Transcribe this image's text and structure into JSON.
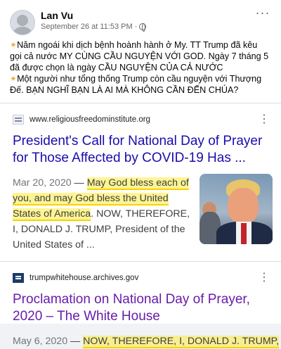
{
  "post": {
    "author": "Lan Vu",
    "timestamp": "September 26 at 11:53 PM",
    "dot": "·",
    "paragraph1": "Năm ngoái khi dịch bệnh hoành hành ở My. TT Trump đã kêu gọi cả nước MY CÙNG CẦU NGUYỆN VỚI GOD.  Ngày 7 tháng 5 đã được chọn là ngày CẦU NGUYỆN CỦA CẢ NƯỚC",
    "paragraph2": "Một người như tổng thống Trump còn cầu nguyện với Thượng Đế. BẠN NGHĨ BẠN LÀ AI MÀ KHÔNG CẦN ĐẾN CHÚA?",
    "spark_icon": "✴",
    "more_icon": "···"
  },
  "results": [
    {
      "site": "www.religiousfreedominstitute.org",
      "title": "President's Call for National Day of Prayer for Those Affected by COVID-19 Has ...",
      "date": "Mar 20, 2020",
      "dash": " — ",
      "highlight": "May God bless each of you, and may God bless the United States of America",
      "rest": ". NOW, THEREFORE, I, DONALD J. TRUMP, President of the United States of ...",
      "kebab": "⋮"
    },
    {
      "site": "trumpwhitehouse.archives.gov",
      "title": "Proclamation on National Day of Prayer, 2020 – The White House",
      "date": "May 6, 2020",
      "dash": " — ",
      "highlight": "NOW, THEREFORE, I, DONALD J. TRUMP,",
      "kebab": "⋮"
    }
  ],
  "colors": {
    "link_blue": "#1a0dab",
    "visited_purple": "#681da8",
    "highlight": "#ffeb3b"
  }
}
